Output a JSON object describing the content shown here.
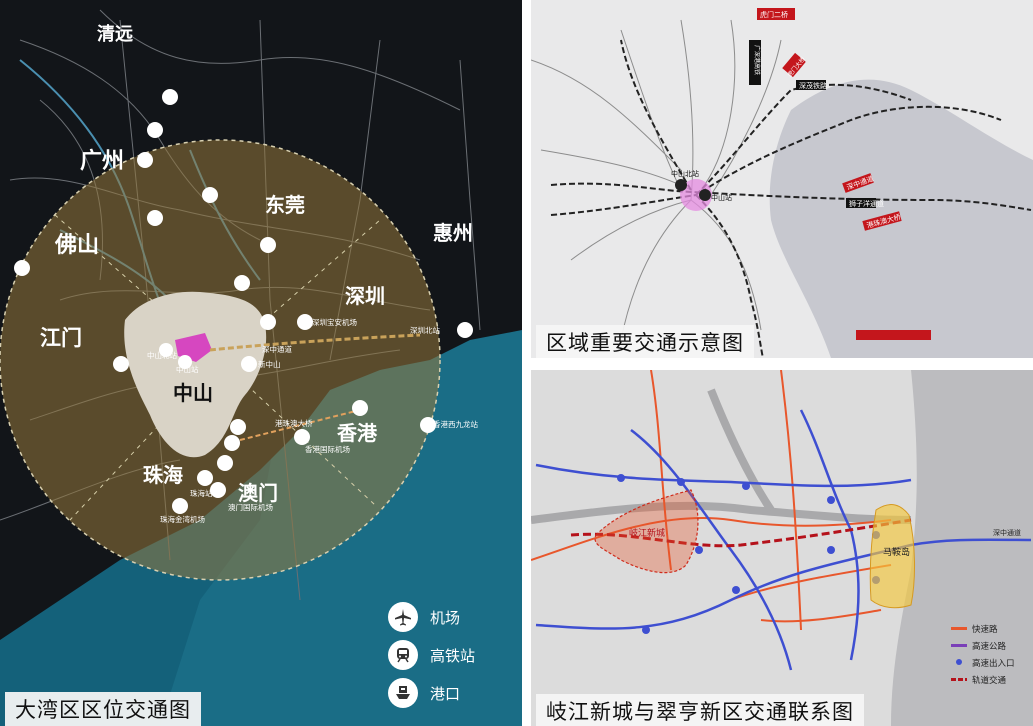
{
  "panels": {
    "left": {
      "caption": "大湾区区位交通图",
      "cities": {
        "qingyuan": "清远",
        "guangzhou": "广州",
        "foshan": "佛山",
        "dongguan": "东莞",
        "huizhou": "惠州",
        "jiangmen": "江门",
        "shenzhen": "深圳",
        "zhongshan": "中山",
        "hongkong": "香港",
        "zhuhai": "珠海",
        "macau": "澳门"
      },
      "stations": {
        "zhongshan_north": "中山北站",
        "zhongshan": "中山站",
        "xinzhongshan": "新中山",
        "shenzhen_airport": "深圳宝安机场",
        "hk_airport": "香港国际机场",
        "hk_west_kowloon": "香港西九龙站",
        "macau_airport": "澳门国际机场",
        "zhuhai_airport": "珠海金湾机场",
        "zhuhai_station": "珠海站",
        "shenzhen_north": "深圳北站",
        "bridge": "港珠澳大桥",
        "zhongshen": "深中通道"
      },
      "legend": [
        {
          "icon": "airport-icon",
          "label": "机场"
        },
        {
          "icon": "railway-station-icon",
          "label": "高铁站"
        },
        {
          "icon": "port-icon",
          "label": "港口"
        }
      ]
    },
    "top_right": {
      "caption": "区域重要交通示意图",
      "labels": {
        "hr_guangzhou": "虎门二桥",
        "hr_humen": "虎门大桥",
        "hr_shenzhong": "深中通道",
        "hr_guangzhou_shenzhen": "广深港高铁",
        "hr_shenmao": "深茂铁路",
        "hr_hk_zh": "港珠澳大桥",
        "hr_shijiao": "狮子洋通道",
        "hr_zhongshan_north": "中山北站",
        "hr_zhongshan": "中山站"
      }
    },
    "bottom_right": {
      "caption": "岐江新城与翠亨新区交通联系图",
      "labels": {
        "qijiang": "岐江新城",
        "maan": "马鞍岛",
        "shenzhong": "深中通道"
      },
      "legend": [
        {
          "label": "快速路",
          "color": "#e8572c"
        },
        {
          "label": "高速公路",
          "color": "#7a3fb8"
        },
        {
          "label": "高速出入口",
          "color": "#3e4fd1"
        },
        {
          "label": "轨道交通",
          "color": "#b5121b"
        }
      ]
    }
  }
}
